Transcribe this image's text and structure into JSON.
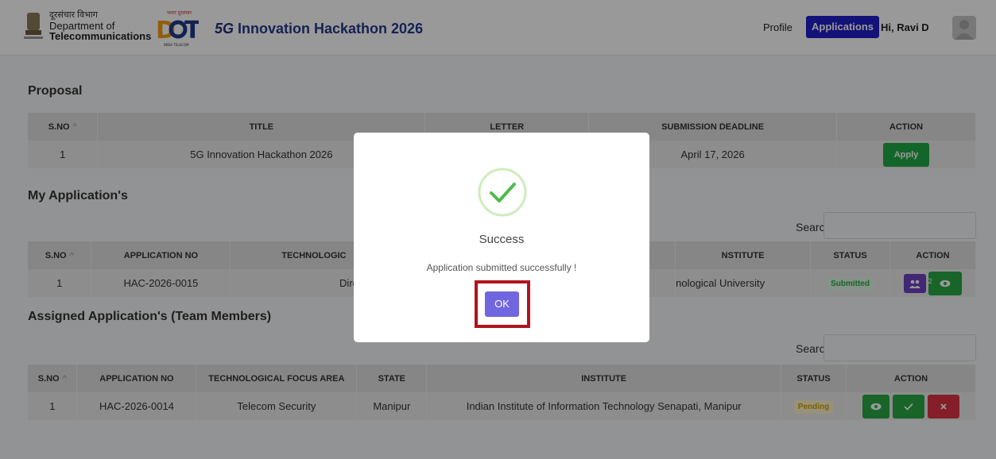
{
  "header": {
    "dept_hindi": "दूरसंचार विभाग",
    "dept_line1": "Department of",
    "dept_line2": "Telecommunications",
    "logo_hindi": "भारत दूरसंचार",
    "logo_sub": "INDIA TELECOM",
    "brand_5g": "5G",
    "brand_rest": " Innovation Hackathon 2026",
    "nav_profile": "Profile",
    "nav_applications": "Applications",
    "greeting": "Hi, Ravi D"
  },
  "proposal": {
    "title": "Proposal",
    "columns": [
      "S.NO",
      "TITLE",
      "LETTER",
      "SUBMISSION DEADLINE",
      "ACTION"
    ],
    "row": {
      "sno": "1",
      "title": "5G Innovation Hackathon 2026",
      "letter": "",
      "deadline": "April 17, 2026",
      "action": "Apply"
    }
  },
  "my_applications": {
    "title": "My Application's",
    "search_label": "Search:",
    "columns": [
      "S.NO",
      "APPLICATION NO",
      "TECHNOLOGIC",
      "NSTITUTE",
      "STATUS",
      "ACTION"
    ],
    "row": {
      "sno": "1",
      "app_no": "HAC-2026-0015",
      "tech": "Direct-to-M",
      "institute": "nological University",
      "status": "Submitted",
      "team_count": "2"
    }
  },
  "assigned": {
    "title": "Assigned Application's (Team Members)",
    "search_label": "Search:",
    "columns": [
      "S.NO",
      "APPLICATION NO",
      "TECHNOLOGICAL FOCUS AREA",
      "STATE",
      "INSTITUTE",
      "STATUS",
      "ACTION"
    ],
    "row": {
      "sno": "1",
      "app_no": "HAC-2026-0014",
      "focus": "Telecom Security",
      "state": "Manipur",
      "institute": "Indian Institute of Information Technology Senapati, Manipur",
      "status": "Pending"
    }
  },
  "modal": {
    "title": "Success",
    "message": "Application submitted successfully !",
    "ok_label": "OK"
  },
  "colors": {
    "accent": "#1e1ec8",
    "success": "#28a745",
    "danger": "#dc3545",
    "ok_button": "#7066e0",
    "highlight_frame": "#b1141e"
  }
}
